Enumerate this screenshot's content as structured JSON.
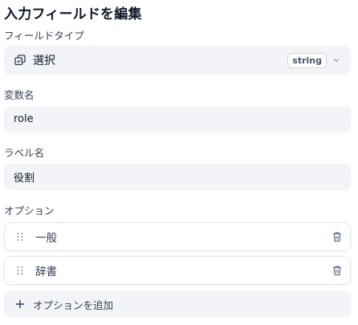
{
  "panel": {
    "title": "入力フィールドを編集"
  },
  "field_type": {
    "label": "フィールドタイプ",
    "value": "選択",
    "type_badge": "string",
    "icon": "copy-select-icon"
  },
  "variable_name": {
    "label": "変数名",
    "value": "role"
  },
  "label_name": {
    "label": "ラベル名",
    "value": "役割"
  },
  "options": {
    "label": "オプション",
    "items": [
      {
        "text": "一般"
      },
      {
        "text": "辞書"
      }
    ],
    "add_label": "オプションを追加"
  }
}
